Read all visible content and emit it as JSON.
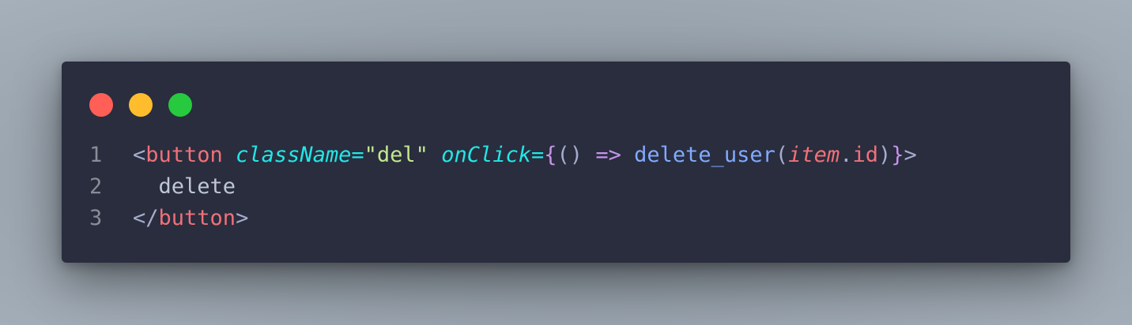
{
  "window": {
    "controls": [
      {
        "name": "close",
        "color": "#ff5f56"
      },
      {
        "name": "minimize",
        "color": "#ffbd2e"
      },
      {
        "name": "maximize",
        "color": "#27c93f"
      }
    ]
  },
  "code": {
    "language": "jsx",
    "lines": [
      {
        "number": "1",
        "tokens": {
          "lt": "<",
          "tag": "button",
          "sp1": " ",
          "attr1": "className",
          "eq1": "=",
          "str1": "\"del\"",
          "sp2": " ",
          "attr2": "onClick",
          "eq2": "=",
          "brace_open": "{",
          "parens": "()",
          "sp3": " ",
          "arrow": "=>",
          "sp4": " ",
          "fn": "delete_user",
          "paren_open": "(",
          "param": "item",
          "dot": ".",
          "prop": "id",
          "paren_close": ")",
          "brace_close": "}",
          "gt": ">"
        }
      },
      {
        "number": "2",
        "tokens": {
          "indent": "  ",
          "text": "delete"
        }
      },
      {
        "number": "3",
        "tokens": {
          "lt_slash": "</",
          "tag": "button",
          "gt": ">"
        }
      }
    ]
  },
  "colors": {
    "background": "#292d3e",
    "tag": "#f07178",
    "attribute": "#22e7e6",
    "string": "#c3e88d",
    "brace": "#c792ea",
    "function": "#82aaff",
    "punctuation": "#a6accd"
  }
}
